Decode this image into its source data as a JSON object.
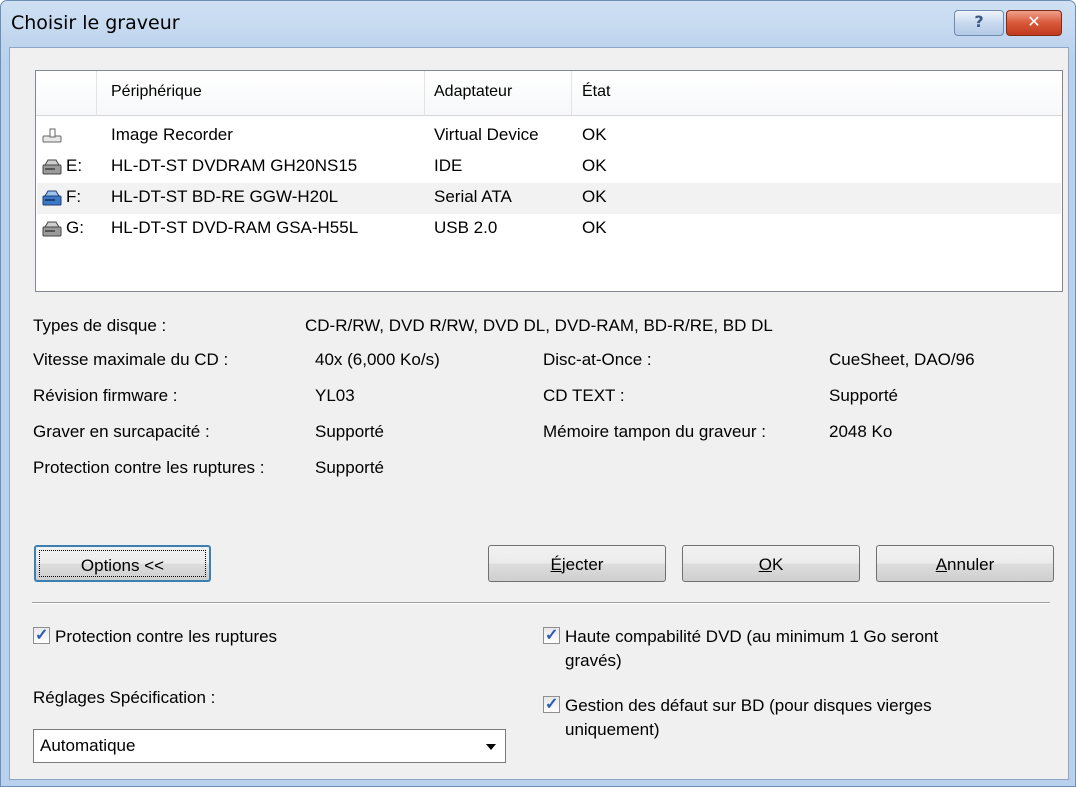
{
  "window": {
    "title": "Choisir le graveur",
    "help_glyph": "?",
    "close_glyph": "✕"
  },
  "list": {
    "columns": [
      "Périphérique",
      "Adaptateur",
      "État"
    ],
    "rows": [
      {
        "drive": "",
        "device": "Image Recorder",
        "adapter": "Virtual Device",
        "state": "OK",
        "icon": "virtual-recorder-icon"
      },
      {
        "drive": "E:",
        "device": "HL-DT-ST DVDRAM GH20NS15",
        "adapter": "IDE",
        "state": "OK",
        "icon": "optical-drive-icon"
      },
      {
        "drive": "F:",
        "device": "HL-DT-ST BD-RE  GGW-H20L",
        "adapter": "Serial ATA",
        "state": "OK",
        "icon": "bluray-drive-icon"
      },
      {
        "drive": "G:",
        "device": "HL-DT-ST DVD-RAM GSA-H55L",
        "adapter": "USB 2.0",
        "state": "OK",
        "icon": "optical-drive-icon"
      }
    ]
  },
  "info": {
    "disc_types_label": "Types de disque :",
    "disc_types_value": "CD-R/RW, DVD R/RW, DVD DL, DVD-RAM, BD-R/RE, BD DL",
    "max_speed_label": "Vitesse maximale du CD :",
    "max_speed_value": "40x (6,000 Ko/s)",
    "firmware_label": "Révision firmware :",
    "firmware_value": "YL03",
    "overburn_label": "Graver en surcapacité :",
    "overburn_value": "Supporté",
    "underrun_label": "Protection contre les ruptures :",
    "underrun_value": "Supporté",
    "dao_label": "Disc-at-Once :",
    "dao_value": "CueSheet, DAO/96",
    "cdtext_label": "CD TEXT :",
    "cdtext_value": "Supporté",
    "buffer_label": "Mémoire tampon du graveur :",
    "buffer_value": "2048 Ko"
  },
  "buttons": {
    "options": "Options <<",
    "eject_first": "É",
    "eject_rest": "jecter",
    "ok_first": "O",
    "ok_rest": "K",
    "cancel_first": "A",
    "cancel_rest": "nnuler"
  },
  "options": {
    "underrun_protection": "Protection contre les ruptures",
    "dvd_compat_line1": "Haute compabilité DVD (au minimum 1 Go seront",
    "dvd_compat_line2": "gravés)",
    "bd_defect_line1": "Gestion des défaut sur BD (pour disques vierges",
    "bd_defect_line2": "uniquement)",
    "spec_label": "Réglages Spécification :",
    "spec_value": "Automatique"
  },
  "colors": {
    "titlebar": "#b9d1ec",
    "close_button": "#d9583a",
    "check_mark": "#2a5ab8"
  }
}
